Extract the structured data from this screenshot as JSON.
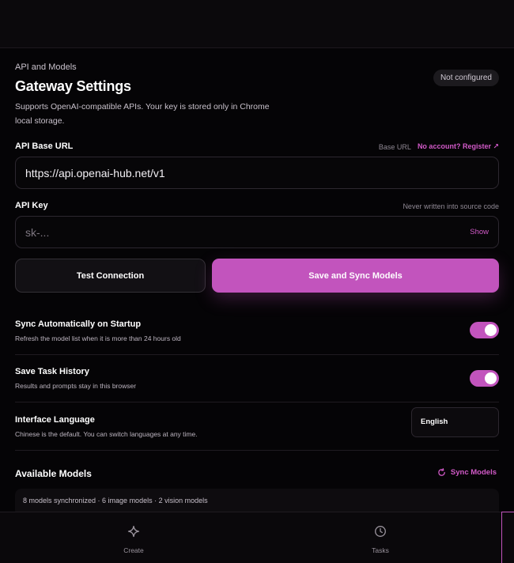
{
  "header": {
    "eyebrow": "API and Models",
    "title": "Gateway Settings",
    "status_badge": "Not configured",
    "description": "Supports OpenAI-compatible APIs. Your key is stored only in Chrome local storage."
  },
  "base_url": {
    "label": "API Base URL",
    "hint": "Base URL",
    "register_link": "No account? Register ↗",
    "value": "https://api.openai-hub.net/v1"
  },
  "api_key": {
    "label": "API Key",
    "hint": "Never written into source code",
    "placeholder": "sk-...",
    "show_label": "Show"
  },
  "actions": {
    "test_label": "Test Connection",
    "save_label": "Save and Sync Models"
  },
  "settings": [
    {
      "title": "Sync Automatically on Startup",
      "subtitle": "Refresh the model list when it is more than 24 hours old",
      "enabled": true
    },
    {
      "title": "Save Task History",
      "subtitle": "Results and prompts stay in this browser",
      "enabled": true
    },
    {
      "title": "Interface Language",
      "subtitle": "Chinese is the default. You can switch languages at any time.",
      "selected": "English"
    }
  ],
  "models": {
    "title": "Available Models",
    "sync_label": "Sync Models",
    "summary": "8 models synchronized · 6 image models · 2 vision models"
  },
  "nav": {
    "create_label": "Create",
    "tasks_label": "Tasks",
    "create_icon": "sparkle-icon",
    "tasks_icon": "clock-icon"
  },
  "colors": {
    "accent": "#c254bd",
    "link": "#d25ac8",
    "background": "#050406"
  }
}
